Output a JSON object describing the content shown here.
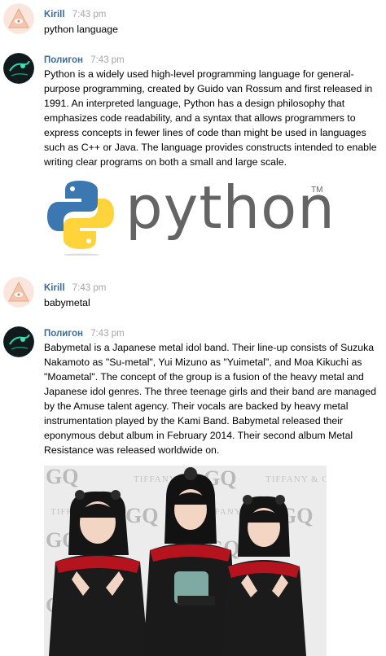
{
  "messages": [
    {
      "sender": "Kirill",
      "time": "7:43 pm",
      "text": "python language"
    },
    {
      "sender": "Полигон",
      "time": "7:43 pm",
      "text": "Python is a widely used high-level programming language for general-purpose programming, created by Guido van Rossum and first released in 1991. An interpreted language, Python has a design philosophy that emphasizes code readability, and a syntax that allows programmers to express concepts in fewer lines of code than might be used in languages such as C++ or Java. The language provides constructs intended to enable writing clear programs on both a small and large scale.",
      "image": {
        "wordmark": "python",
        "trademark": "TM"
      }
    },
    {
      "sender": "Kirill",
      "time": "7:43 pm",
      "text": "babymetal"
    },
    {
      "sender": "Полигон",
      "time": "7:43 pm",
      "text": "Babymetal is a Japanese metal idol band. Their line-up consists of Suzuka Nakamoto as \"Su-metal\", Yui Mizuno as \"Yuimetal\", and Moa Kikuchi as \"Moametal\". The concept of the group is a fusion of the heavy metal and Japanese idol genres. The three teenage girls and their band are managed by the Amuse talent agency. Their vocals are backed by heavy metal instrumentation played by the Kami Band. Babymetal released their eponymous debut album in February 2014. Their second album Metal Resistance was released worldwide on.",
      "image": {
        "backdrop_gq": "GQ",
        "backdrop_brand": "TIFFANY & Co."
      }
    }
  ],
  "colors": {
    "sender": "#3b6c9a",
    "time": "#a6a6a6",
    "python_blue": "#3b77b0",
    "python_yellow": "#ffd43b",
    "python_wordmark": "#646464"
  },
  "icons": {
    "kirill_avatar": "triangle-eye-avatar-icon",
    "bot_avatar": "poligon-bot-avatar-icon",
    "python_logo": "python-snake-logo-icon"
  }
}
